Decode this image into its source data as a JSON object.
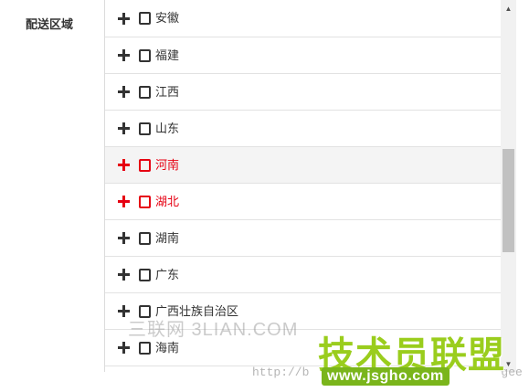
{
  "form": {
    "field_label": "配送区域"
  },
  "region_list": {
    "items": [
      {
        "label": "安徽",
        "state": "normal"
      },
      {
        "label": "福建",
        "state": "normal"
      },
      {
        "label": "江西",
        "state": "normal"
      },
      {
        "label": "山东",
        "state": "normal"
      },
      {
        "label": "河南",
        "state": "active-hover"
      },
      {
        "label": "湖北",
        "state": "active"
      },
      {
        "label": "湖南",
        "state": "normal"
      },
      {
        "label": "广东",
        "state": "normal"
      },
      {
        "label": "广西壮族自治区",
        "state": "normal"
      },
      {
        "label": "海南",
        "state": "normal"
      }
    ],
    "icons": {
      "expand": "plus-icon",
      "select": "checkbox-icon"
    },
    "colors": {
      "text": "#333333",
      "active": "#e60012",
      "hover_bg": "#f4f4f4"
    },
    "scroll_position": 0.4
  },
  "watermarks": {
    "site_small": "三联网 3LIAN.COM",
    "url_text": "http://b",
    "url_tail": "gee",
    "brand": "技术员联盟",
    "domain": "www.jsgho.com"
  }
}
